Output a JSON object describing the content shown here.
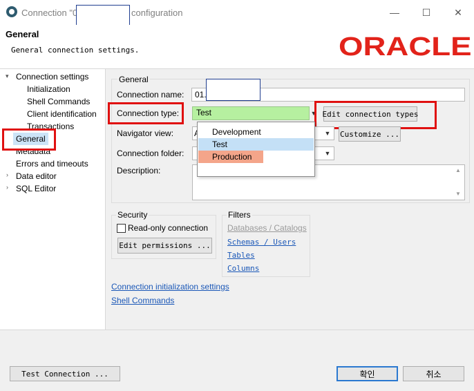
{
  "window": {
    "title_prefix": "Connection \"0",
    "title_suffix": "configuration",
    "minimize_glyph": "—",
    "maximize_glyph": "☐",
    "close_glyph": "✕"
  },
  "header": {
    "title": "General",
    "subtitle": "General connection settings.",
    "logo_text": "ORACLE"
  },
  "tree": {
    "items": [
      {
        "label": "Connection settings",
        "expanded": true
      },
      {
        "label": "Initialization"
      },
      {
        "label": "Shell Commands"
      },
      {
        "label": "Client identification"
      },
      {
        "label": "Transactions"
      },
      {
        "label": "General",
        "selected": true
      },
      {
        "label": "Metadata"
      },
      {
        "label": "Errors and timeouts"
      },
      {
        "label": "Data editor",
        "expandable": true
      },
      {
        "label": "SQL Editor",
        "expandable": true
      }
    ]
  },
  "general": {
    "group_title": "General",
    "connection_name_label": "Connection name:",
    "connection_name_value": "01.",
    "connection_type_label": "Connection type:",
    "connection_type_value": "Test",
    "edit_connection_types_label": "Edit connection types",
    "navigator_view_label": "Navigator view:",
    "navigator_view_value": "A",
    "customize_label": "Customize ...",
    "connection_folder_label": "Connection folder:",
    "description_label": "Description:"
  },
  "dropdown": {
    "options": [
      {
        "label": "Development",
        "color": "#ffffff"
      },
      {
        "label": "Test",
        "color": "#c4e0f6"
      },
      {
        "label": "Production",
        "color": "#f4a58a"
      }
    ]
  },
  "security": {
    "group_title": "Security",
    "read_only_label": "Read-only connection",
    "read_only_checked": false,
    "edit_permissions_label": "Edit permissions ..."
  },
  "filters": {
    "group_title": "Filters",
    "databases_catalogs": "Databases / Catalogs",
    "schemas_users": "Schemas / Users",
    "tables": "Tables",
    "columns": "Columns"
  },
  "links": {
    "connection_init": "Connection initialization settings",
    "shell_commands": "Shell Commands"
  },
  "footer": {
    "test_connection": "Test Connection ...",
    "ok": "확인",
    "cancel": "취소"
  },
  "colors": {
    "highlight_red": "#e01010",
    "oracle_red": "#e2231a",
    "test_green": "#b6f0a0",
    "link_blue": "#1a57b7"
  }
}
